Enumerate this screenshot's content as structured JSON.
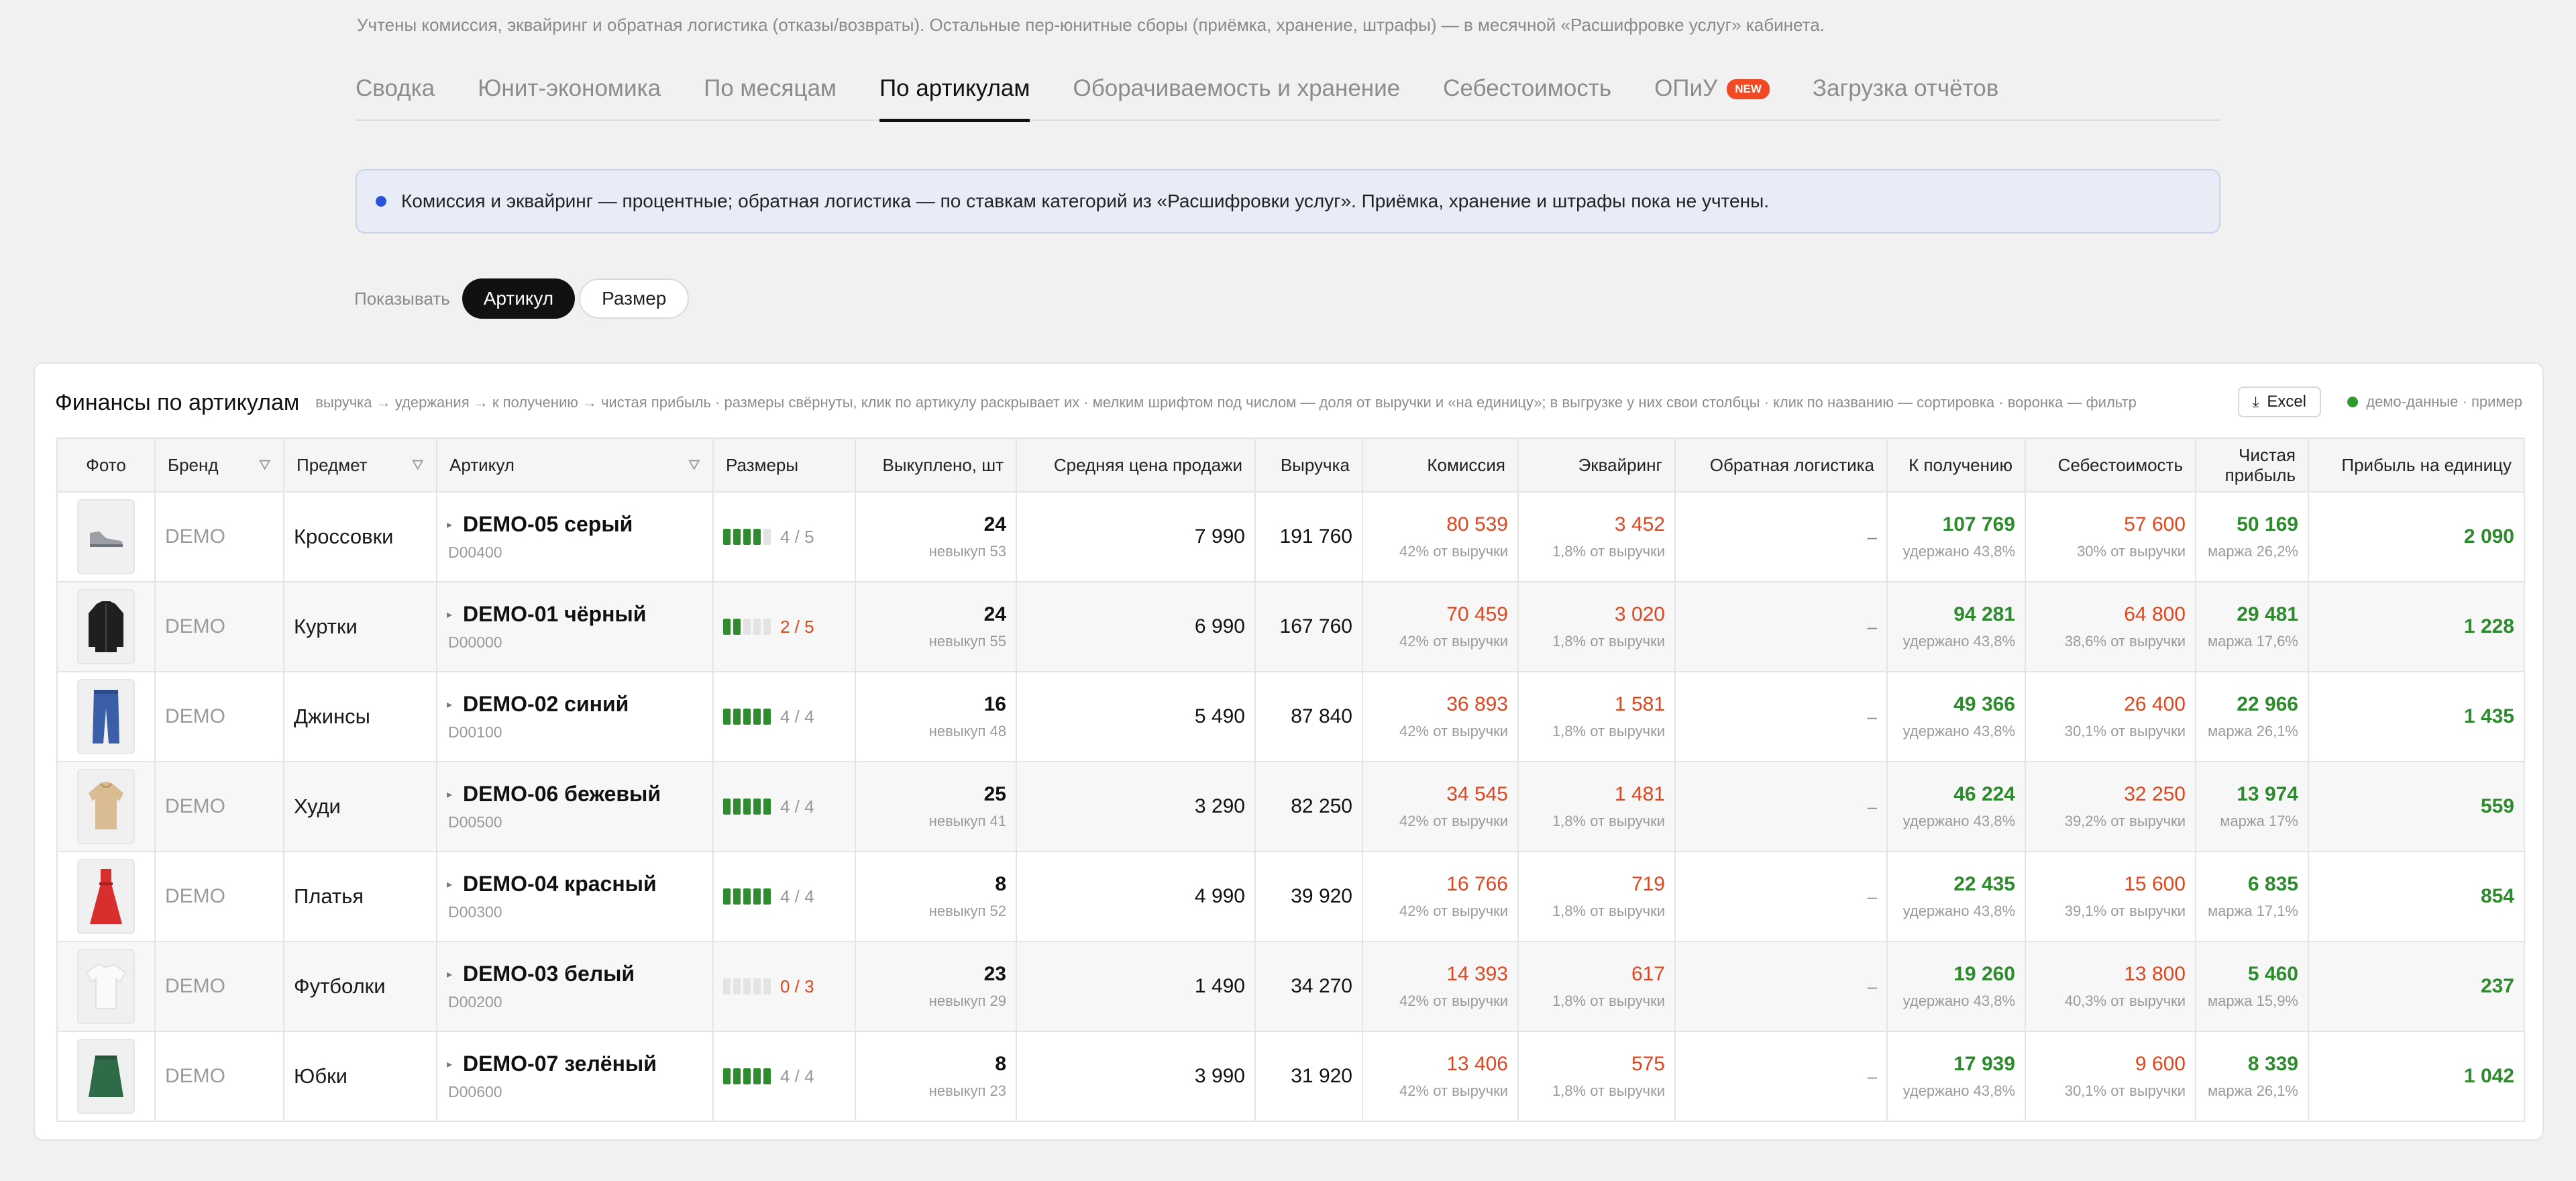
{
  "top_note": "Учтены комиссия, эквайринг и обратная логистика (отказы/возвраты). Остальные пер-юнитные сборы (приёмка, хранение, штрафы) — в месячной «Расшифровке услуг» кабинета.",
  "tabs": [
    {
      "label": "Сводка",
      "active": false
    },
    {
      "label": "Юнит-экономика",
      "active": false
    },
    {
      "label": "По месяцам",
      "active": false
    },
    {
      "label": "По артикулам",
      "active": true
    },
    {
      "label": "Оборачиваемость и хранение",
      "active": false
    },
    {
      "label": "Себестоимость",
      "active": false
    },
    {
      "label": "ОПиУ",
      "active": false,
      "badge": "NEW"
    },
    {
      "label": "Загрузка отчётов",
      "active": false
    }
  ],
  "info": "Комиссия и эквайринг — процентные; обратная логистика — по ставкам категорий из «Расшифровки услуг». Приёмка, хранение и штрафы пока не учтены.",
  "show": {
    "label": "Показывать",
    "options": [
      "Артикул",
      "Размер"
    ],
    "selected": "Артикул"
  },
  "card": {
    "title": "Финансы по артикулам",
    "hint": "выручка → удержания → к получению → чистая прибыль · размеры свёрнуты, клик по артикулу раскрывает их · мелким шрифтом под числом — доля от выручки и «на единицу»; в выгрузке у них свои столбцы · клик по названию — сортировка · воронка — фильтр",
    "excel": "Excel",
    "demo_note": "демо-данные · пример"
  },
  "columns": {
    "photo": "Фото",
    "brand": "Бренд",
    "subject": "Предмет",
    "article": "Артикул",
    "sizes": "Размеры",
    "sold": "Выкуплено, шт",
    "avg_price": "Средняя цена продажи",
    "revenue": "Выручка",
    "commission": "Комиссия",
    "acquiring": "Эквайринг",
    "return_logistics": "Обратная логистика",
    "payout": "К получению",
    "cost": "Себестоимость",
    "net_profit": "Чистая прибыль",
    "unit_profit": "Прибыль на единицу"
  },
  "rows": [
    {
      "icon": "sneaker-icon",
      "brand": "DEMO",
      "subject": "Кроссовки",
      "name": "DEMO-05 серый",
      "code": "D00400",
      "sizes_filled": 4,
      "sizes_text": "4 / 5",
      "sizes_alert": false,
      "sold": "24",
      "sold_sub": "невыкуп 53",
      "avg_price": "7 990",
      "revenue": "191 760",
      "commission": "80 539",
      "commission_sub": "42% от выручки",
      "acquiring": "3 452",
      "acquiring_sub": "1,8% от выручки",
      "return_logistics": "–",
      "payout": "107 769",
      "payout_sub": "удержано 43,8%",
      "cost": "57 600",
      "cost_sub": "30% от выручки",
      "net_profit": "50 169",
      "net_profit_sub": "маржа 26,2%",
      "unit_profit": "2 090"
    },
    {
      "icon": "jacket-icon",
      "brand": "DEMO",
      "subject": "Куртки",
      "name": "DEMO-01 чёрный",
      "code": "D00000",
      "sizes_filled": 2,
      "sizes_text": "2 / 5",
      "sizes_alert": true,
      "sold": "24",
      "sold_sub": "невыкуп 55",
      "avg_price": "6 990",
      "revenue": "167 760",
      "commission": "70 459",
      "commission_sub": "42% от выручки",
      "acquiring": "3 020",
      "acquiring_sub": "1,8% от выручки",
      "return_logistics": "–",
      "payout": "94 281",
      "payout_sub": "удержано 43,8%",
      "cost": "64 800",
      "cost_sub": "38,6% от выручки",
      "net_profit": "29 481",
      "net_profit_sub": "маржа 17,6%",
      "unit_profit": "1 228"
    },
    {
      "icon": "jeans-icon",
      "brand": "DEMO",
      "subject": "Джинсы",
      "name": "DEMO-02 синий",
      "code": "D00100",
      "sizes_filled": 4,
      "sizes_text": "4 / 4",
      "sizes_alert": false,
      "sold": "16",
      "sold_sub": "невыкуп 48",
      "avg_price": "5 490",
      "revenue": "87 840",
      "commission": "36 893",
      "commission_sub": "42% от выручки",
      "acquiring": "1 581",
      "acquiring_sub": "1,8% от выручки",
      "return_logistics": "–",
      "payout": "49 366",
      "payout_sub": "удержано 43,8%",
      "cost": "26 400",
      "cost_sub": "30,1% от выручки",
      "net_profit": "22 966",
      "net_profit_sub": "маржа 26,1%",
      "unit_profit": "1 435"
    },
    {
      "icon": "hoodie-icon",
      "brand": "DEMO",
      "subject": "Худи",
      "name": "DEMO-06 бежевый",
      "code": "D00500",
      "sizes_filled": 4,
      "sizes_text": "4 / 4",
      "sizes_alert": false,
      "sold": "25",
      "sold_sub": "невыкуп 41",
      "avg_price": "3 290",
      "revenue": "82 250",
      "commission": "34 545",
      "commission_sub": "42% от выручки",
      "acquiring": "1 481",
      "acquiring_sub": "1,8% от выручки",
      "return_logistics": "–",
      "payout": "46 224",
      "payout_sub": "удержано 43,8%",
      "cost": "32 250",
      "cost_sub": "39,2% от выручки",
      "net_profit": "13 974",
      "net_profit_sub": "маржа 17%",
      "unit_profit": "559"
    },
    {
      "icon": "dress-icon",
      "brand": "DEMO",
      "subject": "Платья",
      "name": "DEMO-04 красный",
      "code": "D00300",
      "sizes_filled": 4,
      "sizes_text": "4 / 4",
      "sizes_alert": false,
      "sold": "8",
      "sold_sub": "невыкуп 52",
      "avg_price": "4 990",
      "revenue": "39 920",
      "commission": "16 766",
      "commission_sub": "42% от выручки",
      "acquiring": "719",
      "acquiring_sub": "1,8% от выручки",
      "return_logistics": "–",
      "payout": "22 435",
      "payout_sub": "удержано 43,8%",
      "cost": "15 600",
      "cost_sub": "39,1% от выручки",
      "net_profit": "6 835",
      "net_profit_sub": "маржа 17,1%",
      "unit_profit": "854"
    },
    {
      "icon": "tshirt-icon",
      "brand": "DEMO",
      "subject": "Футболки",
      "name": "DEMO-03 белый",
      "code": "D00200",
      "sizes_filled": 0,
      "sizes_text": "0 / 3",
      "sizes_alert": true,
      "sold": "23",
      "sold_sub": "невыкуп 29",
      "avg_price": "1 490",
      "revenue": "34 270",
      "commission": "14 393",
      "commission_sub": "42% от выручки",
      "acquiring": "617",
      "acquiring_sub": "1,8% от выручки",
      "return_logistics": "–",
      "payout": "19 260",
      "payout_sub": "удержано 43,8%",
      "cost": "13 800",
      "cost_sub": "40,3% от выручки",
      "net_profit": "5 460",
      "net_profit_sub": "маржа 15,9%",
      "unit_profit": "237"
    },
    {
      "icon": "skirt-icon",
      "brand": "DEMO",
      "subject": "Юбки",
      "name": "DEMO-07 зелёный",
      "code": "D00600",
      "sizes_filled": 4,
      "sizes_text": "4 / 4",
      "sizes_alert": false,
      "sold": "8",
      "sold_sub": "невыкуп 23",
      "avg_price": "3 990",
      "revenue": "31 920",
      "commission": "13 406",
      "commission_sub": "42% от выручки",
      "acquiring": "575",
      "acquiring_sub": "1,8% от выручки",
      "return_logistics": "–",
      "payout": "17 939",
      "payout_sub": "удержано 43,8%",
      "cost": "9 600",
      "cost_sub": "30,1% от выручки",
      "net_profit": "8 339",
      "net_profit_sub": "маржа 26,1%",
      "unit_profit": "1 042"
    }
  ],
  "colors": {
    "accent_red": "#e0461e",
    "accent_green": "#2d8a2d",
    "info_blue": "#2b55d8",
    "new_badge": "#f04a24"
  }
}
